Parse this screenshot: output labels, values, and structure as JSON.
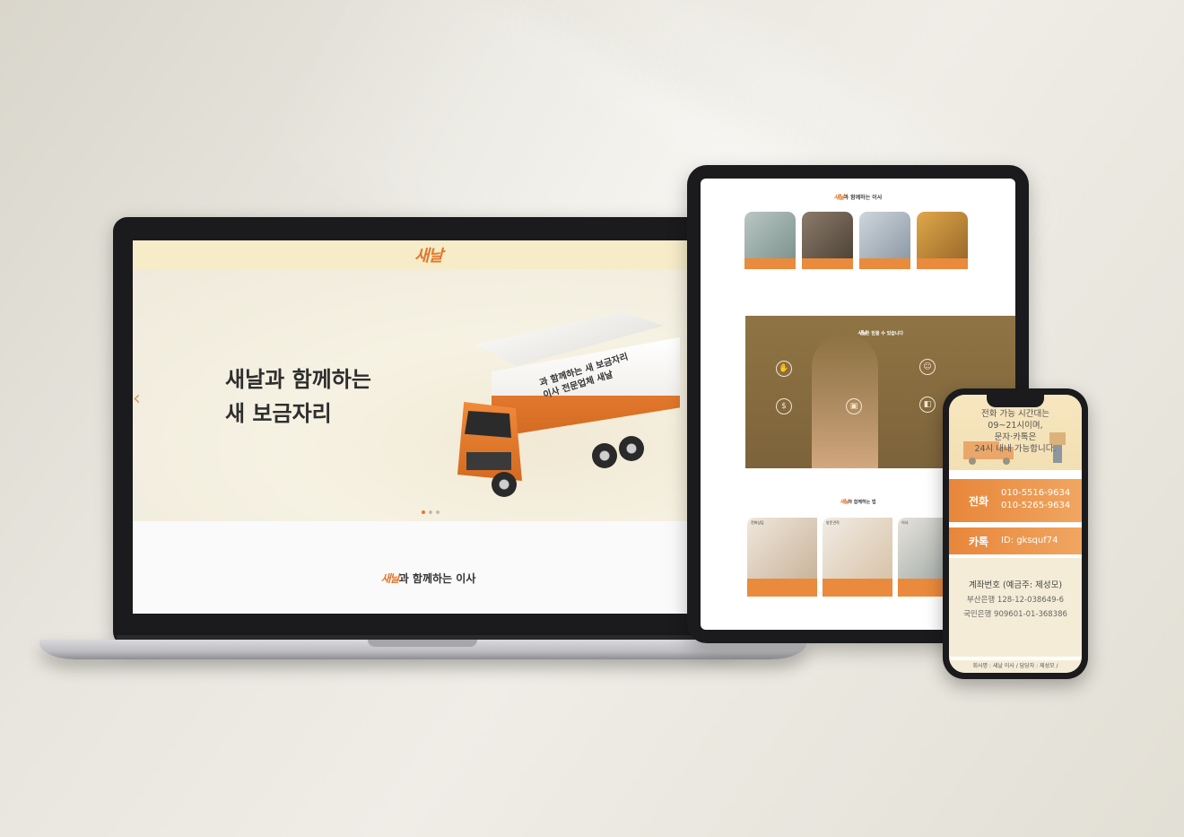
{
  "laptop": {
    "logo": "새날",
    "hero_line1": "새날과 함께하는",
    "hero_line2": "새 보금자리",
    "prev_arrow": "‹",
    "next_arrow": "›",
    "truck_line1": "과 함께하는 새 보금자리",
    "truck_line2": "이사 전문업체 새날",
    "bottom_title": "과 함께하는 이사"
  },
  "tablet": {
    "top_title": "과 함께하는 이사",
    "brown_title": "은 믿을 수 있습니다",
    "process_title": "과 함께하는 법",
    "steps": [
      {
        "caption": "전화상담"
      },
      {
        "caption": "방문견적"
      },
      {
        "caption": "이사"
      }
    ]
  },
  "phone": {
    "notice_line1": "전화 가능 시간대는",
    "notice_line2": "09~21시이며,",
    "notice_line3": "문자·카톡은",
    "notice_line4": "24시 내내 가능합니다.",
    "phone_label": "전화",
    "phone_1": "010-5516-9634",
    "phone_2": "010-5265-9634",
    "kakao_label": "카톡",
    "kakao_id": "ID: gksquf74",
    "bank_title": "계좌번호 (예금주: 제성모)",
    "bank_1": "부산은행 128-12-038649-6",
    "bank_2": "국민은행 909601-01-368386",
    "footer": "회사명 : 새날 이사 / 담당자 : 제성모 /"
  },
  "colors": {
    "accent": "#e2782d",
    "header_bg": "#f6ecc8",
    "brown": "#8f7444"
  }
}
